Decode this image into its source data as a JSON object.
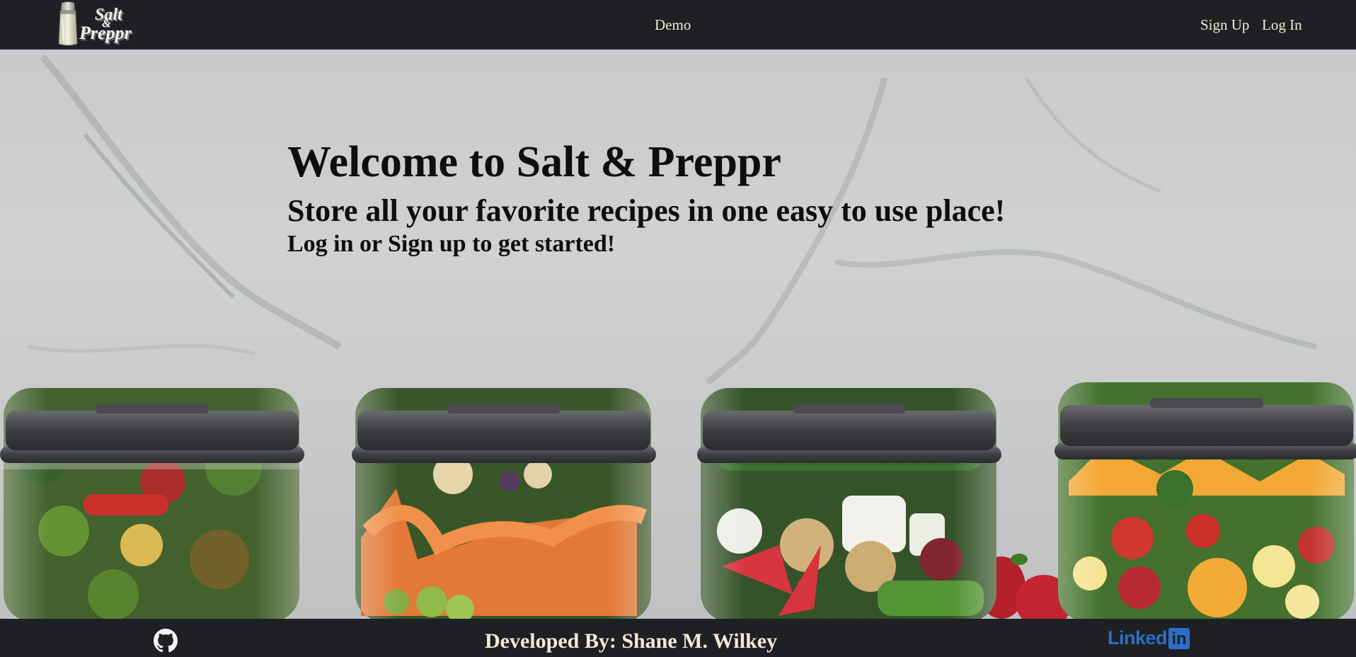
{
  "navbar": {
    "logo": {
      "line1": "Salt",
      "line2": "&",
      "line3": "Preppr",
      "icon": "salt-shaker-icon"
    },
    "demo_label": "Demo",
    "signup_label": "Sign Up",
    "login_label": "Log In"
  },
  "hero": {
    "title": "Welcome to Salt & Preppr",
    "subtitle": "Store all your favorite recipes in one easy to use place!",
    "cta": "Log in or Sign up to get started!",
    "background": "salad-jars-on-marble-photo"
  },
  "footer": {
    "credit": "Developed By: Shane M. Wilkey",
    "github_icon": "github-icon",
    "linkedin": {
      "word": "Linked",
      "box": "in",
      "icon": "linkedin-logo-icon"
    }
  },
  "colors": {
    "nav_bg": "#1f2024",
    "nav_text": "#f3ead6",
    "hero_text": "#0e0e0e",
    "linkedin_blue": "#2d6ec6"
  }
}
